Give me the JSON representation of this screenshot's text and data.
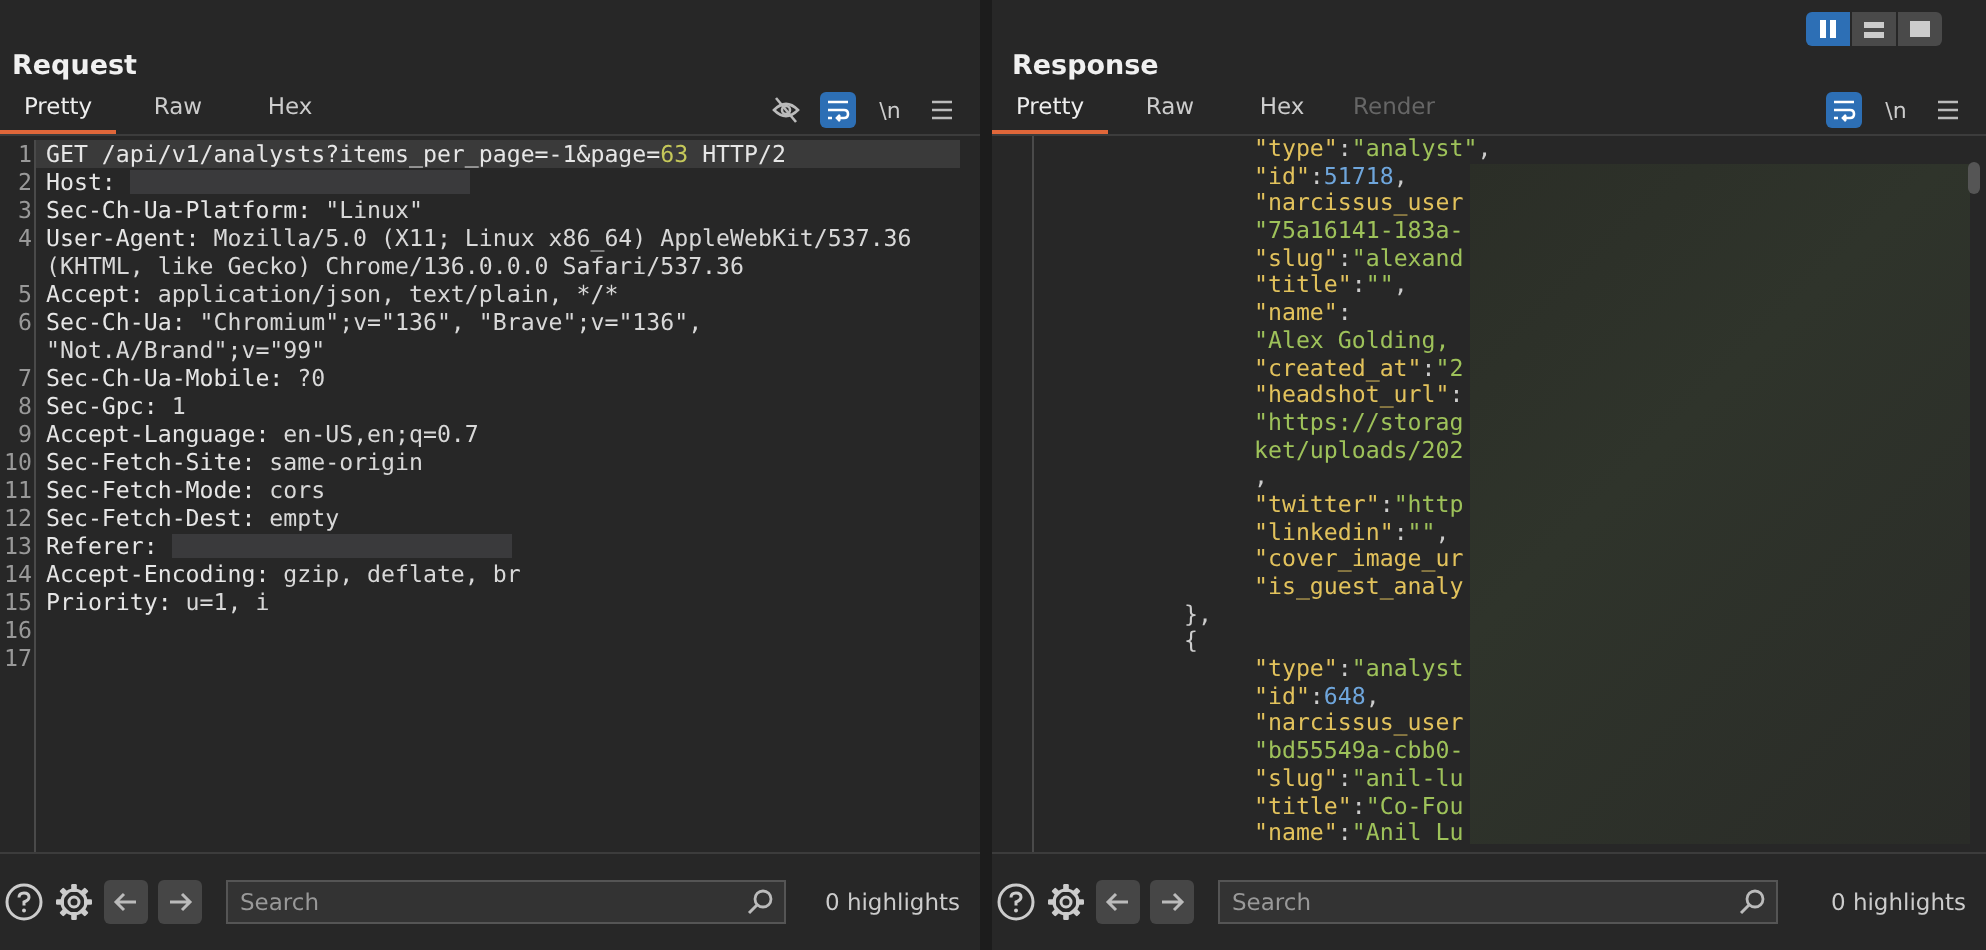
{
  "layout_buttons": [
    {
      "kind": "columns",
      "selected": true
    },
    {
      "kind": "rows",
      "selected": false
    },
    {
      "kind": "single",
      "selected": false
    }
  ],
  "request": {
    "title": "Request",
    "tabs": [
      {
        "label": "Pretty",
        "selected": true,
        "disabled": false
      },
      {
        "label": "Raw",
        "selected": false,
        "disabled": false
      },
      {
        "label": "Hex",
        "selected": false,
        "disabled": false
      }
    ],
    "tools": [
      {
        "kind": "hide",
        "on": false
      },
      {
        "kind": "wrap",
        "on": true
      },
      {
        "kind": "newline",
        "label": "\\n",
        "on": false
      },
      {
        "kind": "menu",
        "on": false
      }
    ],
    "rows": [
      {
        "number": "1",
        "current": true,
        "segments": [
          {
            "kind": "name",
            "text": "GET /api/v1/analysts?items_per_page=-1&page="
          },
          {
            "kind": "num",
            "text": "63"
          },
          {
            "kind": "name",
            "text": " HTTP/2"
          }
        ]
      },
      {
        "number": "2",
        "current": false,
        "segments": [
          {
            "kind": "name",
            "text": "Host:"
          },
          {
            "kind": "redacted"
          }
        ]
      },
      {
        "number": "3",
        "current": false,
        "segments": [
          {
            "kind": "name",
            "text": "Sec-Ch-Ua-Platform:"
          },
          {
            "kind": "value",
            "text": " \"Linux\""
          }
        ]
      },
      {
        "number": "4",
        "current": false,
        "segments": [
          {
            "kind": "name",
            "text": "User-Agent:"
          },
          {
            "kind": "value",
            "text": " Mozilla/5.0 (X11; Linux x86_64) AppleWebKit/537.36"
          }
        ]
      },
      {
        "current": false,
        "segments": [
          {
            "kind": "value",
            "text": "(KHTML, like Gecko) Chrome/136.0.0.0 Safari/537.36"
          }
        ]
      },
      {
        "number": "5",
        "current": false,
        "segments": [
          {
            "kind": "name",
            "text": "Accept:"
          },
          {
            "kind": "value",
            "text": " application/json, text/plain, */*"
          }
        ]
      },
      {
        "number": "6",
        "current": false,
        "segments": [
          {
            "kind": "name",
            "text": "Sec-Ch-Ua:"
          },
          {
            "kind": "value",
            "text": " \"Chromium\";v=\"136\", \"Brave\";v=\"136\","
          }
        ]
      },
      {
        "current": false,
        "segments": [
          {
            "kind": "value",
            "text": "\"Not.A/Brand\";v=\"99\""
          }
        ]
      },
      {
        "number": "7",
        "current": false,
        "segments": [
          {
            "kind": "name",
            "text": "Sec-Ch-Ua-Mobile:"
          },
          {
            "kind": "value",
            "text": " ?0"
          }
        ]
      },
      {
        "number": "8",
        "current": false,
        "segments": [
          {
            "kind": "name",
            "text": "Sec-Gpc:"
          },
          {
            "kind": "value",
            "text": " 1"
          }
        ]
      },
      {
        "number": "9",
        "current": false,
        "segments": [
          {
            "kind": "name",
            "text": "Accept-Language:"
          },
          {
            "kind": "value",
            "text": " en-US,en;q=0.7"
          }
        ]
      },
      {
        "number": "10",
        "current": false,
        "segments": [
          {
            "kind": "name",
            "text": "Sec-Fetch-Site:"
          },
          {
            "kind": "value",
            "text": " same-origin"
          }
        ]
      },
      {
        "number": "11",
        "current": false,
        "segments": [
          {
            "kind": "name",
            "text": "Sec-Fetch-Mode:"
          },
          {
            "kind": "value",
            "text": " cors"
          }
        ]
      },
      {
        "number": "12",
        "current": false,
        "segments": [
          {
            "kind": "name",
            "text": "Sec-Fetch-Dest:"
          },
          {
            "kind": "value",
            "text": " empty"
          }
        ]
      },
      {
        "number": "13",
        "current": false,
        "segments": [
          {
            "kind": "name",
            "text": "Referer:"
          },
          {
            "kind": "redacted"
          }
        ]
      },
      {
        "number": "14",
        "current": false,
        "segments": [
          {
            "kind": "name",
            "text": "Accept-Encoding:"
          },
          {
            "kind": "value",
            "text": " gzip, deflate, br"
          }
        ]
      },
      {
        "number": "15",
        "current": false,
        "segments": [
          {
            "kind": "name",
            "text": "Priority:"
          },
          {
            "kind": "value",
            "text": " u=1, i"
          }
        ]
      },
      {
        "number": "16"
      },
      {
        "number": "17"
      }
    ],
    "footer": {
      "search_placeholder": "Search",
      "highlights": "0 highlights"
    }
  },
  "response": {
    "title": "Response",
    "tabs": [
      {
        "label": "Pretty",
        "selected": true,
        "disabled": false
      },
      {
        "label": "Raw",
        "selected": false,
        "disabled": false
      },
      {
        "label": "Hex",
        "selected": false,
        "disabled": false
      },
      {
        "label": "Render",
        "selected": false,
        "disabled": true
      }
    ],
    "tools": [
      {
        "kind": "wrap",
        "on": true
      },
      {
        "kind": "newline",
        "label": "\\n",
        "on": false
      },
      {
        "kind": "menu",
        "on": false
      }
    ],
    "lines": [
      {
        "children": [
          {
            "segments": [
              {
                "kind": "key",
                "text": "\"type\""
              },
              {
                "kind": "punct",
                "text": ":"
              },
              {
                "kind": "str",
                "text": "\"analyst\""
              },
              {
                "kind": "punct",
                "text": ","
              }
            ]
          },
          {
            "segments": [
              {
                "kind": "key",
                "text": "\"id\""
              },
              {
                "kind": "punct",
                "text": ":"
              },
              {
                "kind": "num",
                "text": "51718"
              },
              {
                "kind": "punct",
                "text": ","
              }
            ]
          },
          {
            "segments": [
              {
                "kind": "key",
                "text": "\"narcissus_user"
              }
            ]
          },
          {
            "segments": [
              {
                "kind": "str",
                "text": "\"75a16141-183a-"
              }
            ]
          },
          {
            "segments": [
              {
                "kind": "key",
                "text": "\"slug\""
              },
              {
                "kind": "punct",
                "text": ":"
              },
              {
                "kind": "str",
                "text": "\"alexand"
              }
            ]
          },
          {
            "segments": [
              {
                "kind": "key",
                "text": "\"title\""
              },
              {
                "kind": "punct",
                "text": ":"
              },
              {
                "kind": "str",
                "text": "\"\""
              },
              {
                "kind": "punct",
                "text": ","
              }
            ]
          },
          {
            "segments": [
              {
                "kind": "key",
                "text": "\"name\""
              },
              {
                "kind": "punct",
                "text": ":"
              }
            ]
          },
          {
            "segments": [
              {
                "kind": "str",
                "text": "\"Alex Golding,"
              }
            ]
          },
          {
            "segments": [
              {
                "kind": "key",
                "text": "\"created_at\""
              },
              {
                "kind": "punct",
                "text": ":"
              },
              {
                "kind": "str",
                "text": "\"2"
              }
            ]
          },
          {
            "segments": [
              {
                "kind": "key",
                "text": "\"headshot_url\""
              },
              {
                "kind": "punct",
                "text": ":"
              }
            ]
          },
          {
            "segments": [
              {
                "kind": "str",
                "text": "\"https://storag"
              }
            ]
          },
          {
            "segments": [
              {
                "kind": "str",
                "text": "ket/uploads/202"
              }
            ]
          },
          {
            "segments": [
              {
                "kind": "punct",
                "text": ","
              }
            ]
          },
          {
            "segments": [
              {
                "kind": "key",
                "text": "\"twitter\""
              },
              {
                "kind": "punct",
                "text": ":"
              },
              {
                "kind": "str",
                "text": "\"http"
              }
            ]
          },
          {
            "segments": [
              {
                "kind": "key",
                "text": "\"linkedin\""
              },
              {
                "kind": "punct",
                "text": ":"
              },
              {
                "kind": "str",
                "text": "\"\""
              },
              {
                "kind": "punct",
                "text": ","
              }
            ]
          },
          {
            "segments": [
              {
                "kind": "key",
                "text": "\"cover_image_ur"
              }
            ]
          },
          {
            "segments": [
              {
                "kind": "key",
                "text": "\"is_guest_analy"
              }
            ]
          }
        ]
      },
      {
        "segments": [
          {
            "kind": "punct",
            "text": "},"
          }
        ]
      },
      {
        "segments": [
          {
            "kind": "punct",
            "text": "{"
          }
        ],
        "children": [
          {
            "segments": [
              {
                "kind": "key",
                "text": "\"type\""
              },
              {
                "kind": "punct",
                "text": ":"
              },
              {
                "kind": "str",
                "text": "\"analyst"
              }
            ]
          },
          {
            "segments": [
              {
                "kind": "key",
                "text": "\"id\""
              },
              {
                "kind": "punct",
                "text": ":"
              },
              {
                "kind": "num",
                "text": "648"
              },
              {
                "kind": "punct",
                "text": ","
              }
            ]
          },
          {
            "segments": [
              {
                "kind": "key",
                "text": "\"narcissus_user"
              }
            ]
          },
          {
            "segments": [
              {
                "kind": "str",
                "text": "\"bd55549a-cbb0-"
              }
            ]
          },
          {
            "segments": [
              {
                "kind": "key",
                "text": "\"slug\""
              },
              {
                "kind": "punct",
                "text": ":"
              },
              {
                "kind": "str",
                "text": "\"anil-lu"
              }
            ]
          },
          {
            "segments": [
              {
                "kind": "key",
                "text": "\"title\""
              },
              {
                "kind": "punct",
                "text": ":"
              },
              {
                "kind": "str",
                "text": "\"Co-Fou"
              }
            ]
          },
          {
            "segments": [
              {
                "kind": "key",
                "text": "\"name\""
              },
              {
                "kind": "punct",
                "text": ":"
              },
              {
                "kind": "str",
                "text": "\"Anil Lu"
              }
            ]
          }
        ]
      }
    ],
    "footer": {
      "search_placeholder": "Search",
      "highlights": "0 highlights"
    }
  }
}
